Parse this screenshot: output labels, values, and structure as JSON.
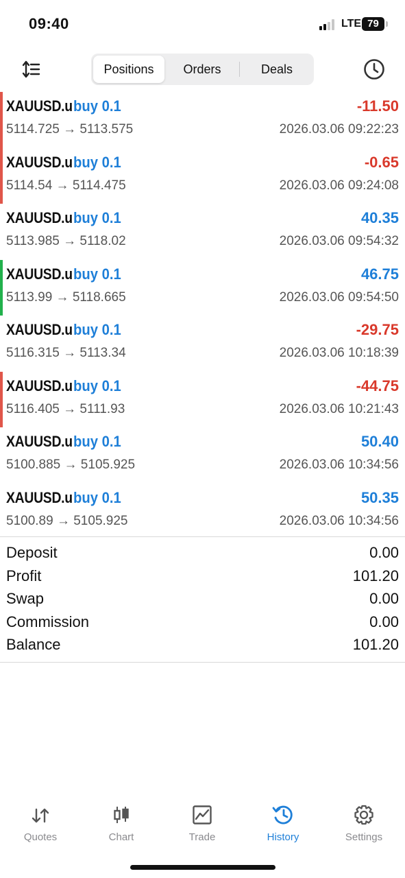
{
  "status_bar": {
    "time": "09:40",
    "network": "LTE",
    "battery": "79"
  },
  "header": {
    "tabs": [
      {
        "label": "Positions",
        "active": true
      },
      {
        "label": "Orders",
        "active": false
      },
      {
        "label": "Deals",
        "active": false
      }
    ],
    "left_icon": "sort-icon",
    "right_icon": "clock-history-icon"
  },
  "deals": [
    {
      "symbol": "XAUUSD.u",
      "side": "buy 0.1",
      "profit": "-11.50",
      "prices": "5114.725 → 5113.575",
      "time": "2026.03.06 09:22:23",
      "marker": "#e0564a"
    },
    {
      "symbol": "XAUUSD.u",
      "side": "buy 0.1",
      "profit": "-0.65",
      "prices": "5114.54 → 5114.475",
      "time": "2026.03.06 09:24:08",
      "marker": "#e0564a"
    },
    {
      "symbol": "XAUUSD.u",
      "side": "buy 0.1",
      "profit": "40.35",
      "prices": "5113.985 → 5118.02",
      "time": "2026.03.06 09:54:32",
      "marker": ""
    },
    {
      "symbol": "XAUUSD.u",
      "side": "buy 0.1",
      "profit": "46.75",
      "prices": "5113.99 → 5118.665",
      "time": "2026.03.06 09:54:50",
      "marker": "#22b14c"
    },
    {
      "symbol": "XAUUSD.u",
      "side": "buy 0.1",
      "profit": "-29.75",
      "prices": "5116.315 → 5113.34",
      "time": "2026.03.06 10:18:39",
      "marker": ""
    },
    {
      "symbol": "XAUUSD.u",
      "side": "buy 0.1",
      "profit": "-44.75",
      "prices": "5116.405 → 5111.93",
      "time": "2026.03.06 10:21:43",
      "marker": "#e0564a"
    },
    {
      "symbol": "XAUUSD.u",
      "side": "buy 0.1",
      "profit": "50.40",
      "prices": "5100.885 → 5105.925",
      "time": "2026.03.06 10:34:56",
      "marker": ""
    },
    {
      "symbol": "XAUUSD.u",
      "side": "buy 0.1",
      "profit": "50.35",
      "prices": "5100.89 → 5105.925",
      "time": "2026.03.06 10:34:56",
      "marker": ""
    }
  ],
  "summary": [
    {
      "label": "Deposit",
      "value": "0.00"
    },
    {
      "label": "Profit",
      "value": "101.20"
    },
    {
      "label": "Swap",
      "value": "0.00"
    },
    {
      "label": "Commission",
      "value": "0.00"
    },
    {
      "label": "Balance",
      "value": "101.20"
    }
  ],
  "tabbar": [
    {
      "label": "Quotes",
      "icon": "quotes-icon",
      "active": false
    },
    {
      "label": "Chart",
      "icon": "chart-icon",
      "active": false
    },
    {
      "label": "Trade",
      "icon": "trade-icon",
      "active": false
    },
    {
      "label": "History",
      "icon": "history-icon",
      "active": true
    },
    {
      "label": "Settings",
      "icon": "settings-icon",
      "active": false
    }
  ],
  "colors": {
    "accent": "#1e7fd8",
    "loss": "#d9392b",
    "gain": "#1e7fd8"
  }
}
